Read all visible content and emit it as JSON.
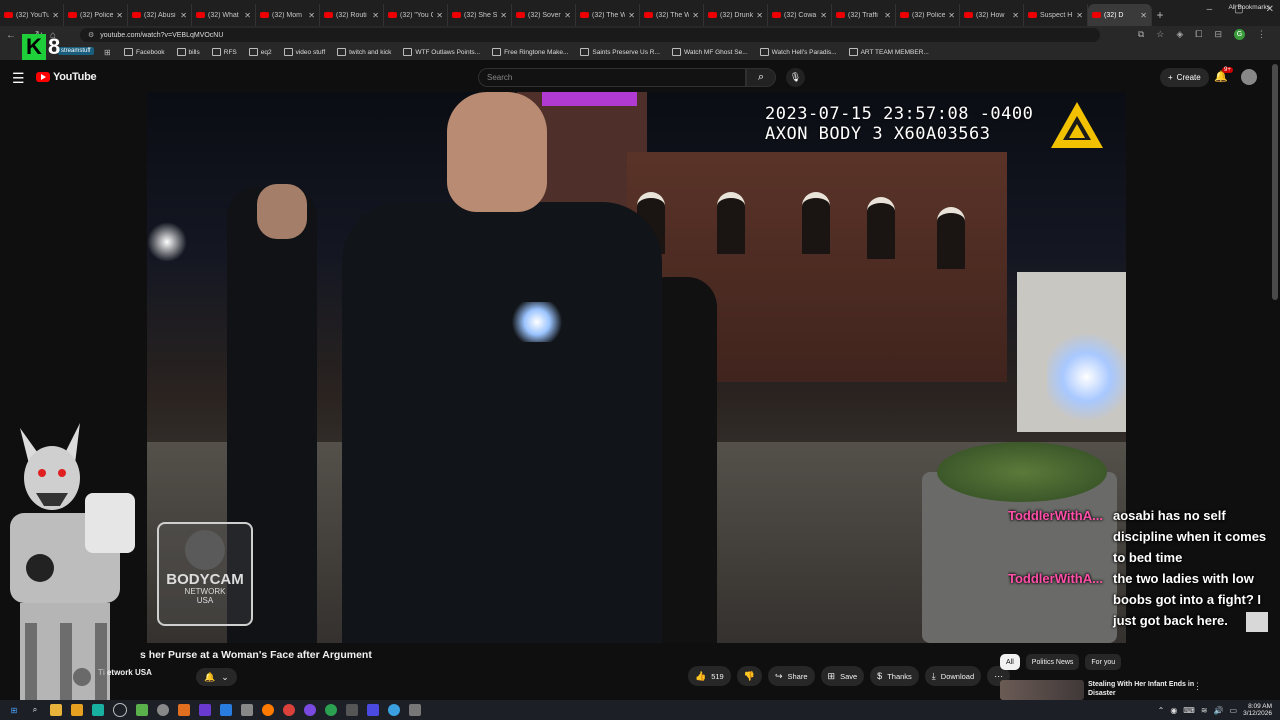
{
  "browser": {
    "tabs": [
      {
        "title": "(32) YouTu"
      },
      {
        "title": "(32) Police"
      },
      {
        "title": "(32) Abusi"
      },
      {
        "title": "(32) What"
      },
      {
        "title": "(32) Mom"
      },
      {
        "title": "(32) Routi"
      },
      {
        "title": "(32) \"You C"
      },
      {
        "title": "(32) She S"
      },
      {
        "title": "(32) Sover"
      },
      {
        "title": "(32) The W"
      },
      {
        "title": "(32) The W"
      },
      {
        "title": "(32) Drunk"
      },
      {
        "title": "(32) Cowa"
      },
      {
        "title": "(32) Traffi"
      },
      {
        "title": "(32) Police"
      },
      {
        "title": "(32) How"
      },
      {
        "title": "Suspect H"
      },
      {
        "title": "(32) D"
      }
    ],
    "url": "youtube.com/watch?v=VEBLqMVOcNU",
    "bookmark_tag": "streamstuff",
    "bookmarks": [
      {
        "label": "Facebook"
      },
      {
        "label": "bills"
      },
      {
        "label": "RFS"
      },
      {
        "label": "eq2"
      },
      {
        "label": "video stuff"
      },
      {
        "label": "twitch and kick"
      },
      {
        "label": "WTF Outlaws Points..."
      },
      {
        "label": "Free Ringtone Make..."
      },
      {
        "label": "Saints Preserve Us R..."
      },
      {
        "label": "Watch MF Ghost Se..."
      },
      {
        "label": "Watch Hell's Paradis..."
      },
      {
        "label": "ART TEAM MEMBER..."
      }
    ],
    "all_bookmarks": "All Bookmarks",
    "profile_initial": "G"
  },
  "overlay": {
    "logo_letter": "K",
    "logo_number": "8"
  },
  "youtube": {
    "logo_text": "YouTube",
    "search_placeholder": "Search",
    "create_label": "Create",
    "notif_badge": "9+"
  },
  "video": {
    "timestamp": "2023-07-15 23:57:08 -0400",
    "device": "AXON BODY 3 X60A03563",
    "watermark_line1": "BODYCAM",
    "watermark_line2": "NETWORK",
    "watermark_line3": "USA"
  },
  "video_info": {
    "title": "s her Purse at a Woman's Face after Argument",
    "channel": "etwork USA",
    "channel_prefix": "Ti",
    "likes": "519",
    "share_label": "Share",
    "save_label": "Save",
    "thanks_label": "Thanks",
    "download_label": "Download"
  },
  "recommendations": {
    "chips": [
      {
        "label": "All",
        "selected": true
      },
      {
        "label": "Politics News",
        "selected": false
      },
      {
        "label": "For you",
        "selected": false
      }
    ],
    "first_title": "Stealing With Her Infant Ends in Disaster"
  },
  "chat": [
    {
      "user": "ToddlerWithA...",
      "text": "aosabi has no self discipline when it comes to bed time"
    },
    {
      "user": "ToddlerWithA...",
      "text": "the two ladies with low boobs got into a fight? I just got back here."
    }
  ],
  "taskbar": {
    "time": "8:09 AM",
    "date": "3/12/2026"
  }
}
